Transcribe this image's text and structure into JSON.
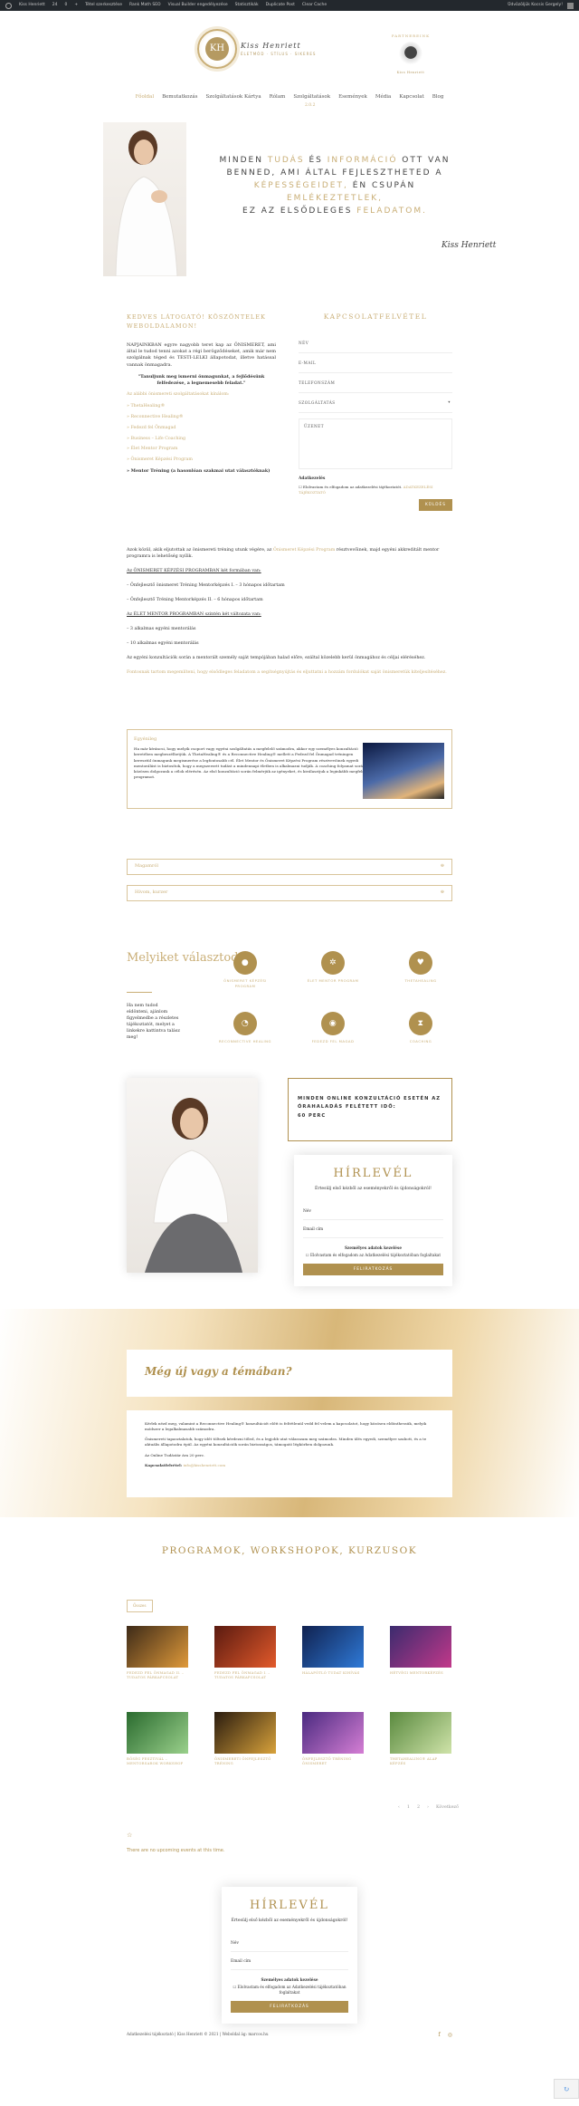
{
  "admin": {
    "items": [
      "Kiss Henriett",
      "24",
      "0",
      "+",
      "Tétel szerkesztése",
      "Rank Math SEO",
      "Visual Builder engedélyezése",
      "Statisztikák",
      "Duplicate Post",
      "Clear Cache"
    ],
    "greeting": "Üdvözöljük Kocsis Gergely!"
  },
  "header": {
    "logo_initials": "KH",
    "logo_name": "Kiss Henriett",
    "logo_tagline": "ÉLETMÓD · STÍLUS · SIKERES",
    "partner_title": "PARTNEREINK",
    "partner_caption": "Kiss Henriett"
  },
  "nav": {
    "items": [
      "Főoldal",
      "Bemutatkozás",
      "Szolgáltatások Kártya",
      "Rólam",
      "Szolgáltatások",
      "Események",
      "Média",
      "Kapcsolat",
      "Blog"
    ],
    "sub": "2.0.2"
  },
  "hero": {
    "w1": "MINDEN",
    "w2": "TUDÁS",
    "w3": "ÉS",
    "w4": "INFORMÁCIÓ",
    "w5": "OTT VAN",
    "l2": "BENNED, AMI ÁLTAL FEJLESZTHETED A",
    "w6": "KÉPESSÉGEIDET,",
    "w7": "ÉN CSUPÁN",
    "w8": "EMLÉKEZTETLEK,",
    "l4a": "EZ AZ ELSŐDLEGES",
    "w9": "FELADATOM.",
    "signature": "Kiss Henriett"
  },
  "intro": {
    "title": "KEDVES LÁTOGATÓ! KÖSZÖNTELEK WEBOLDALAMON!",
    "p1": "NAPJAINKBAN egyre nagyobb teret kap az ÖNISMERET, ami által le tudod tenni azokat a régi berögződéseket, amik már nem szolgálnak téged és TESTI-LELKI állapotodat, illetve hatással vannak önmagadra.",
    "quote": "\"Tanuljunk meg ismerni önmagunkat, a fejlődésünk felfedezése, a legnemesebb feladat.\"",
    "lead": "Az alábbi önismereti szolgáltatásokat kínálom:",
    "services": [
      "» ThetaHealing®",
      "» Reconnective Healing®",
      "» Fedezd fel Önmagad",
      "» Business – Life Coaching",
      "» Élet Mentor Program",
      "» Önismeret Képzési Program"
    ],
    "mentor": "» Mentor Tréning (a hasonlóan szakmai utat választóknak)"
  },
  "contact": {
    "title": "KAPCSOLATFELVÉTEL",
    "f1": "NÉV",
    "f2": "E-MAIL",
    "f3": "TELEFONSZÁM",
    "f4": "SZOLGÁLTATÁS",
    "f5": "ÜZENET",
    "consent_title": "Adatkezelés",
    "consent_text": "Elolvastam és elfogadom az adatkezelési tájékoztatót.",
    "consent_link": "ADATKEZELÉSI TÁJÉKOZTATÓ",
    "send": "KÜLDÉS"
  },
  "program": {
    "p1": "Azok közül, akik eljutottak az önismereti tréning utunk végére, az",
    "p1_link": "Önismeret Képzési Program",
    "p1_end": "résztvevőinek, majd egyéni akkreditált mentor programra is lehetőség nyílik.",
    "h1": "Az ÖNISMERET KÉPZÉSI PROGRAMBAN két formában van:",
    "i1": "– Önfejlesztő önismeret Tréning Mentorképzés I. – 3 hónapos időtartam",
    "i2": "– Önfejlesztő Tréning Mentorképzés II. – 6 hónapos időtartam",
    "h2": "Az ÉLET MENTOR PROGRAMBAN szintén két változata van:",
    "i3": "– 3 alkalmas egyéni mentorálás",
    "i4": "– 10 alkalmas egyéni mentorálás",
    "p2": "Az egyéni konzultációk során a mentorált személy saját tempójában halad előre, ezáltal közelebb kerül önmagához és céljai eléréséhez.",
    "p3": "Fontosnak tartom megemlíteni, hogy elsődleges feladatom a segítségnyújtás és eljuttatni a hozzám fordulókat saját önismeretük kiteljesítéséhez."
  },
  "box": {
    "title": "Egyénileg",
    "text": "Ha már kíváncsi, hogy melyik csoport vagy egyéni szolgáltatás a megfelelő számodra, akkor egy személyes konzultáció keretében megbeszélhetjük. A ThetaHealing® és a Reconnective Healing® mellett a Fedezd fel Önmagad tréningen keresztül önmagunk megismerése a legfontosabb cél. Élet Mentor és Önismeret Képzési Program résztvevőinek egyedi mentorálást is biztosítok, hogy a megszerzett tudást a mindennapi életben is alkalmazni tudják. A coaching folyamat során közösen dolgozunk a célok elérésén. Az első konzultáció során felmérjük az igényeket, és kiválasztjuk a leginkább megfelelő programot.",
    "acc1": "Magamról",
    "acc2": "Hívom, kurzer"
  },
  "services": {
    "title": "Melyiket választod?",
    "text": "Ha nem tudod eldönteni, ajánlom figyelmedbe a részletes tájékoztatót, melyet a linkekre kattintva talász meg!",
    "items": [
      {
        "icon": "●",
        "label": "ÖNISMERET KÉPZÉSI PROGRAM"
      },
      {
        "icon": "✲",
        "label": "ÉLET MENTOR PROGRAM"
      },
      {
        "icon": "♥",
        "label": "THETAHEALING"
      },
      {
        "icon": "◔",
        "label": "RECONNECTIVE HEALING"
      },
      {
        "icon": "◉",
        "label": "FEDEZD FEL MAGAD"
      },
      {
        "icon": "⧗",
        "label": "COACHING"
      }
    ]
  },
  "online": {
    "l1": "MINDEN ONLINE KONZULTÁCIÓ ESETÉN AZ",
    "l2": "ÓRAHALADÁS FELÉTETT IDŐ:",
    "l3": "60 PERC"
  },
  "newsletter": {
    "title": "HÍRLEVÉL",
    "desc": "Értesülj első kézből az eseményekről és újdonságokról!",
    "name": "Név",
    "email": "Email cím",
    "privacy": "Személyes adatok kezelése",
    "consent": "Elolvastam és elfogadom az Adatkezelési tájékoztatóban foglaltakat",
    "button": "FELIRATKOZÁS"
  },
  "band": {
    "title": "Még új vagy a témában?",
    "p1": "Kérlek nézd meg, valamint a Reconnective Healing® konzultációt előtt is feltétlenül vedd fel velem a kapcsolatot, hogy közösen eldönthessük, melyik módszer a legalkalmasabb számodra.",
    "p2": "Önismereti tapasztalatok, hogy időt töltsek kérdezni tőled, és a legjobb utat válasszam meg számodra. Minden ülés egyedi, személyre szabott, és a te aktuális állapotodra épül. Az egyéni konzultációk során biztonságos, támogató légkörben dolgozunk.",
    "p3": "Az Online Tudástár ára 20 perc.",
    "contact_label": "Kapcsolatfelvétel:",
    "contact_link": "info@kisshenriett.com"
  },
  "programs": {
    "title": "PROGRAMOK, WORKSHOPOK, KURZUSOK",
    "filter": "Összes",
    "tiles": [
      {
        "title": "Fedezd fel önmagad II. – Tudatos párkapcsolat",
        "c1": "#3d2a18",
        "c2": "#e09a3a"
      },
      {
        "title": "Fedezd fel önmagad I. – Tudatos párkapcsolat",
        "c1": "#5a1a10",
        "c2": "#e35a2b"
      },
      {
        "title": "Hálapótló Tudat Kihívás",
        "c1": "#10214f",
        "c2": "#2f7ad8"
      },
      {
        "title": "Hétvégi mentorképzés",
        "c1": "#3b2b6e",
        "c2": "#c2388a"
      },
      {
        "title": "Bőség Fesztivál – Mentorsarok Workshop",
        "c1": "#2a6b2f",
        "c2": "#9ad08b"
      },
      {
        "title": "Önismereti önfejlesztő tréning",
        "c1": "#2a1c0f",
        "c2": "#d8a23b"
      },
      {
        "title": "Önfejlesztő tréning önismeret",
        "c1": "#4a2a80",
        "c2": "#d57ed4"
      },
      {
        "title": "ThetaHealing® alap képzés",
        "c1": "#5a8a3f",
        "c2": "#cfe3a9"
      }
    ],
    "pager": [
      "‹",
      "1",
      "2",
      "›",
      "Következő"
    ]
  },
  "events": {
    "icon": "☆",
    "text": "There are no upcoming events at this time."
  },
  "footer": {
    "text": "Adatkezelési tájékoztató | Kiss Henriett © 2021 | Weboldal ág: marcos.hu",
    "fb": "f",
    "ig": "◎"
  },
  "recaptcha": "↻"
}
